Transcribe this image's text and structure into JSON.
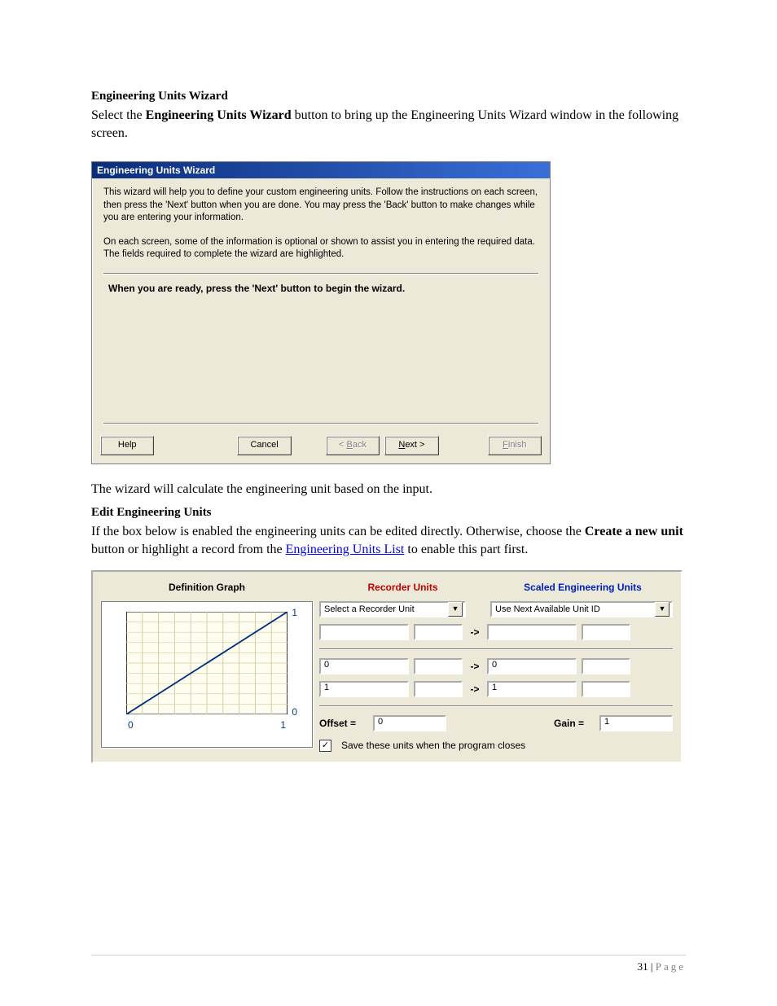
{
  "sections": {
    "wizardTitle": "Engineering Units Wizard",
    "wizardIntroPrefix": "Select the ",
    "wizardIntroBold": "Engineering Units Wizard",
    "wizardIntroSuffix": " button to bring up the Engineering Units Wizard window in the following screen.",
    "wizardCalc": "The wizard will calculate the engineering unit based on the input.",
    "editTitle": "Edit Engineering Units",
    "editP_prefix": "If the box below is enabled the engineering units can be edited directly. Otherwise, choose the ",
    "editP_bold": "Create a new unit",
    "editP_mid": " button or highlight a record from the ",
    "editP_link": "Engineering Units List",
    "editP_suffix": " to enable this part first."
  },
  "wizardDialog": {
    "title": "Engineering Units Wizard",
    "p1": "This wizard will help you to define your custom engineering units. Follow the instructions on each screen, then press the 'Next' button when you are done. You may press the 'Back' button to make changes while you are entering your information.",
    "p2": "On each screen, some of the information is optional or shown to assist you in entering the required data. The fields required to complete the wizard are highlighted.",
    "ready": "When you are ready, press the 'Next' button to begin the wizard.",
    "buttons": {
      "help": "Help",
      "cancel": "Cancel",
      "backPre": "< ",
      "backKey": "B",
      "backPost": "ack",
      "nextKey": "N",
      "nextPost": "ext >",
      "finishKey": "F",
      "finishPost": "inish"
    }
  },
  "euPanel": {
    "headers": {
      "defGraph": "Definition Graph",
      "recorder": "Recorder Units",
      "scaled": "Scaled Engineering Units"
    },
    "recorderSelect": "Select a Recorder Unit",
    "scaledSelect": "Use Next Available Unit ID",
    "row2": {
      "left": "0",
      "right": "0"
    },
    "row3": {
      "left": "1",
      "right": "1"
    },
    "offsetLabel": "Offset =",
    "offsetVal": "0",
    "gainLabel": "Gain =",
    "gainVal": "1",
    "saveCheck": "Save these units when the program closes",
    "graph": {
      "xmin": "0",
      "xmax": "1",
      "ymin": "0",
      "ymax": "1"
    },
    "arrow": "->"
  },
  "footer": {
    "pageNum": "31",
    "sep": " | ",
    "pageWord": "Page"
  }
}
